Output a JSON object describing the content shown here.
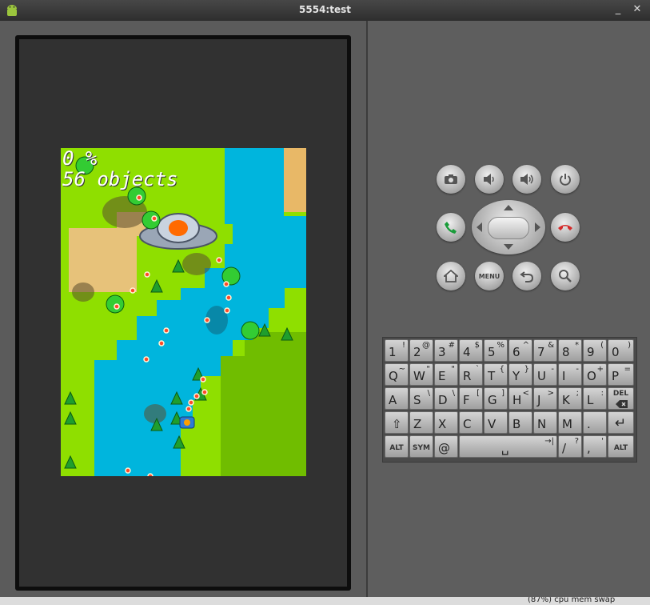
{
  "window": {
    "title": "5554:test"
  },
  "titlebar": {
    "app_icon": "android-icon",
    "minimize_label": "_",
    "close_label": "✕"
  },
  "game": {
    "percent_text": "0 %",
    "objects_text": "56 objects"
  },
  "hardware_buttons": {
    "camera": "camera-icon",
    "volume_down": "volume-down-icon",
    "volume_up": "volume-up-icon",
    "power": "power-icon",
    "call": "call-icon",
    "end_call": "end-call-icon",
    "home": "home-icon",
    "menu_label": "MENU",
    "back": "back-icon",
    "search": "search-icon"
  },
  "keyboard": {
    "rows": [
      [
        {
          "main": "1",
          "alt": "!"
        },
        {
          "main": "2",
          "alt": "@"
        },
        {
          "main": "3",
          "alt": "#"
        },
        {
          "main": "4",
          "alt": "$"
        },
        {
          "main": "5",
          "alt": "%"
        },
        {
          "main": "6",
          "alt": "^"
        },
        {
          "main": "7",
          "alt": "&"
        },
        {
          "main": "8",
          "alt": "*"
        },
        {
          "main": "9",
          "alt": "("
        },
        {
          "main": "0",
          "alt": ")"
        }
      ],
      [
        {
          "main": "Q",
          "alt": "~"
        },
        {
          "main": "W",
          "alt": "\""
        },
        {
          "main": "E",
          "alt": "\""
        },
        {
          "main": "R",
          "alt": "`"
        },
        {
          "main": "T",
          "alt": "{"
        },
        {
          "main": "Y",
          "alt": "}"
        },
        {
          "main": "U",
          "alt": "-"
        },
        {
          "main": "I",
          "alt": "-"
        },
        {
          "main": "O",
          "alt": "+"
        },
        {
          "main": "P",
          "alt": "="
        }
      ],
      [
        {
          "main": "A",
          "alt": ""
        },
        {
          "main": "S",
          "alt": "\\"
        },
        {
          "main": "D",
          "alt": "\\"
        },
        {
          "main": "F",
          "alt": "["
        },
        {
          "main": "G",
          "alt": "]"
        },
        {
          "main": "H",
          "alt": "<"
        },
        {
          "main": "J",
          "alt": ">"
        },
        {
          "main": "K",
          "alt": ";"
        },
        {
          "main": "L",
          "alt": ":"
        },
        {
          "main": "DEL",
          "alt": ""
        }
      ],
      [
        {
          "main": "⇧",
          "alt": ""
        },
        {
          "main": "Z",
          "alt": ""
        },
        {
          "main": "X",
          "alt": ""
        },
        {
          "main": "C",
          "alt": ""
        },
        {
          "main": "V",
          "alt": ""
        },
        {
          "main": "B",
          "alt": ""
        },
        {
          "main": "N",
          "alt": ""
        },
        {
          "main": "M",
          "alt": ""
        },
        {
          "main": ".",
          "alt": ""
        },
        {
          "main": "↵",
          "alt": ""
        }
      ],
      [
        {
          "main": "ALT",
          "alt": ""
        },
        {
          "main": "SYM",
          "alt": ""
        },
        {
          "main": "@",
          "alt": ""
        },
        {
          "main": "␣",
          "alt": "→|"
        },
        {
          "main": "/",
          "alt": "?"
        },
        {
          "main": ",",
          "alt": "'"
        },
        {
          "main": "ALT",
          "alt": ""
        }
      ]
    ]
  },
  "statusbar": {
    "text": "(87%) cpu  mem  swap"
  }
}
